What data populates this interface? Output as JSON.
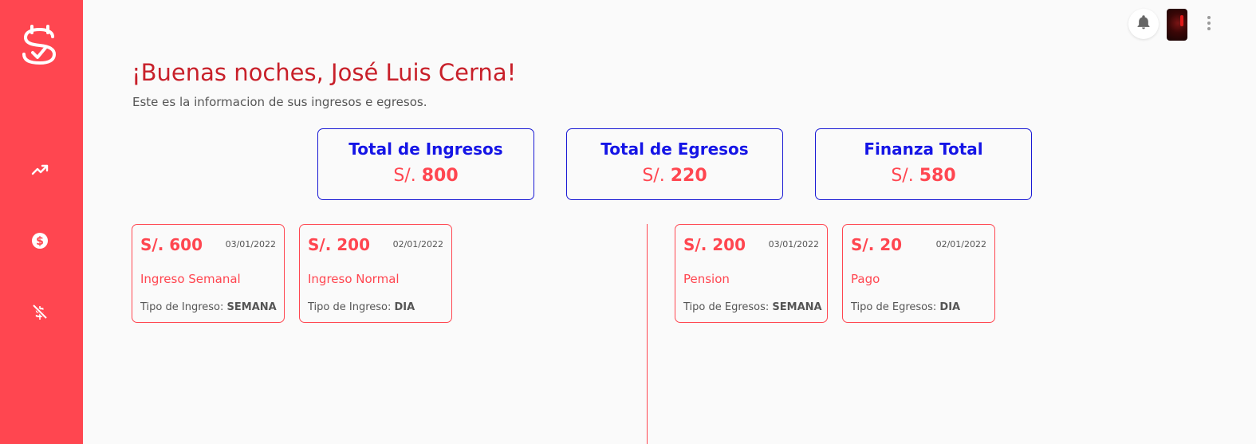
{
  "sidebar": {
    "items": [
      {
        "icon": "trending-up-icon"
      },
      {
        "icon": "dollar-circle-icon"
      },
      {
        "icon": "dollar-off-icon"
      }
    ]
  },
  "header": {
    "greeting": "¡Buenas noches, José Luis Cerna!",
    "subtitle": "Este es la informacion de sus ingresos e egresos."
  },
  "summary": [
    {
      "title": "Total de Ingresos",
      "currency": "S/.",
      "amount": "800"
    },
    {
      "title": "Total de Egresos",
      "currency": "S/.",
      "amount": "220"
    },
    {
      "title": "Finanza Total",
      "currency": "S/.",
      "amount": "580"
    }
  ],
  "ingresos": [
    {
      "amount": "S/. 600",
      "date": "03/01/2022",
      "name": "Ingreso Semanal",
      "type_label": "Tipo de Ingreso:",
      "type_value": "SEMANA"
    },
    {
      "amount": "S/. 200",
      "date": "02/01/2022",
      "name": "Ingreso Normal",
      "type_label": "Tipo de Ingreso:",
      "type_value": "DIA"
    }
  ],
  "egresos": [
    {
      "amount": "S/. 200",
      "date": "03/01/2022",
      "name": "Pension",
      "type_label": "Tipo de Egresos:",
      "type_value": "SEMANA"
    },
    {
      "amount": "S/. 20",
      "date": "02/01/2022",
      "name": "Pago",
      "type_label": "Tipo de Egresos:",
      "type_value": "DIA"
    }
  ],
  "colors": {
    "accent": "#ff4650",
    "greeting": "#c8202a",
    "summary_border": "#1a1ad4",
    "summary_title": "#1515e6",
    "background": "#fafafa"
  }
}
